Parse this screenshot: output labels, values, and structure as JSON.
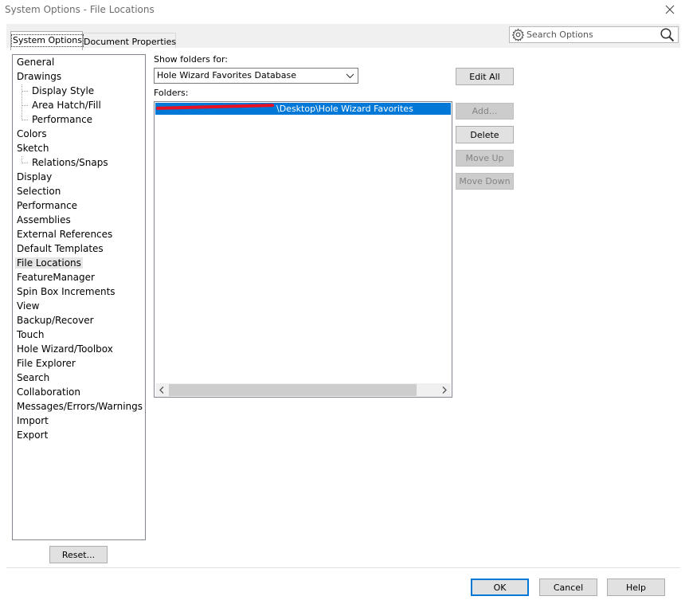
{
  "window": {
    "title": "System Options - File Locations"
  },
  "tabs": [
    {
      "label": "System Options",
      "active": true
    },
    {
      "label": "Document Properties",
      "active": false
    }
  ],
  "search": {
    "placeholder": "Search Options"
  },
  "tree": {
    "items": [
      {
        "label": "General",
        "level": 0
      },
      {
        "label": "Drawings",
        "level": 0
      },
      {
        "label": "Display Style",
        "level": 1
      },
      {
        "label": "Area Hatch/Fill",
        "level": 1
      },
      {
        "label": "Performance",
        "level": 1
      },
      {
        "label": "Colors",
        "level": 0
      },
      {
        "label": "Sketch",
        "level": 0
      },
      {
        "label": "Relations/Snaps",
        "level": 1
      },
      {
        "label": "Display",
        "level": 0
      },
      {
        "label": "Selection",
        "level": 0
      },
      {
        "label": "Performance",
        "level": 0
      },
      {
        "label": "Assemblies",
        "level": 0
      },
      {
        "label": "External References",
        "level": 0
      },
      {
        "label": "Default Templates",
        "level": 0
      },
      {
        "label": "File Locations",
        "level": 0,
        "selected": true
      },
      {
        "label": "FeatureManager",
        "level": 0
      },
      {
        "label": "Spin Box Increments",
        "level": 0
      },
      {
        "label": "View",
        "level": 0
      },
      {
        "label": "Backup/Recover",
        "level": 0
      },
      {
        "label": "Touch",
        "level": 0
      },
      {
        "label": "Hole Wizard/Toolbox",
        "level": 0
      },
      {
        "label": "File Explorer",
        "level": 0
      },
      {
        "label": "Search",
        "level": 0
      },
      {
        "label": "Collaboration",
        "level": 0
      },
      {
        "label": "Messages/Errors/Warnings",
        "level": 0
      },
      {
        "label": "Import",
        "level": 0
      },
      {
        "label": "Export",
        "level": 0
      }
    ]
  },
  "show_folders": {
    "label": "Show folders for:",
    "selected": "Hole Wizard Favorites Database"
  },
  "folders": {
    "label": "Folders:",
    "items": [
      "\\Desktop\\Hole Wizard Favorites"
    ]
  },
  "buttons": {
    "edit_all": "Edit All",
    "add": "Add...",
    "delete": "Delete",
    "move_up": "Move Up",
    "move_down": "Move Down",
    "reset": "Reset...",
    "ok": "OK",
    "cancel": "Cancel",
    "help": "Help"
  },
  "colors": {
    "accent": "#0078d7",
    "selection_bg": "#0078d7",
    "redaction": "#e81123"
  }
}
